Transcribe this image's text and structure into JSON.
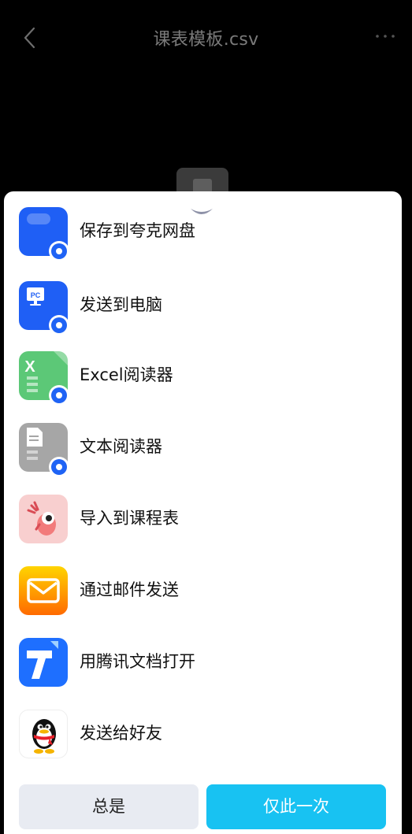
{
  "header": {
    "title": "课表模板.csv",
    "back_icon": "chevron-left-icon",
    "more_icon": "more-dots-icon"
  },
  "sheet": {
    "collapse_icon": "chevron-down-icon",
    "items": [
      {
        "label": "保存到夸克网盘",
        "icon": "quark-cloud-icon",
        "color": "#1f5ff5"
      },
      {
        "label": "发送到电脑",
        "icon": "pc-icon",
        "color": "#1f5ff5"
      },
      {
        "label": "Excel阅读器",
        "icon": "excel-icon",
        "color": "#5cc877"
      },
      {
        "label": "文本阅读器",
        "icon": "text-doc-icon",
        "color": "#a6a6a6"
      },
      {
        "label": "导入到课程表",
        "icon": "deer-icon",
        "color": "#f8cfcf"
      },
      {
        "label": "通过邮件发送",
        "icon": "mail-icon",
        "color": "#ffb100"
      },
      {
        "label": "用腾讯文档打开",
        "icon": "tencent-docs-icon",
        "color": "#1e6fff"
      },
      {
        "label": "发送给好友",
        "icon": "qq-penguin-icon",
        "color": "#000000"
      }
    ],
    "pc_icon_text": "PC",
    "excel_icon_text": "X",
    "buttons": {
      "always": "总是",
      "once": "仅此一次"
    }
  }
}
